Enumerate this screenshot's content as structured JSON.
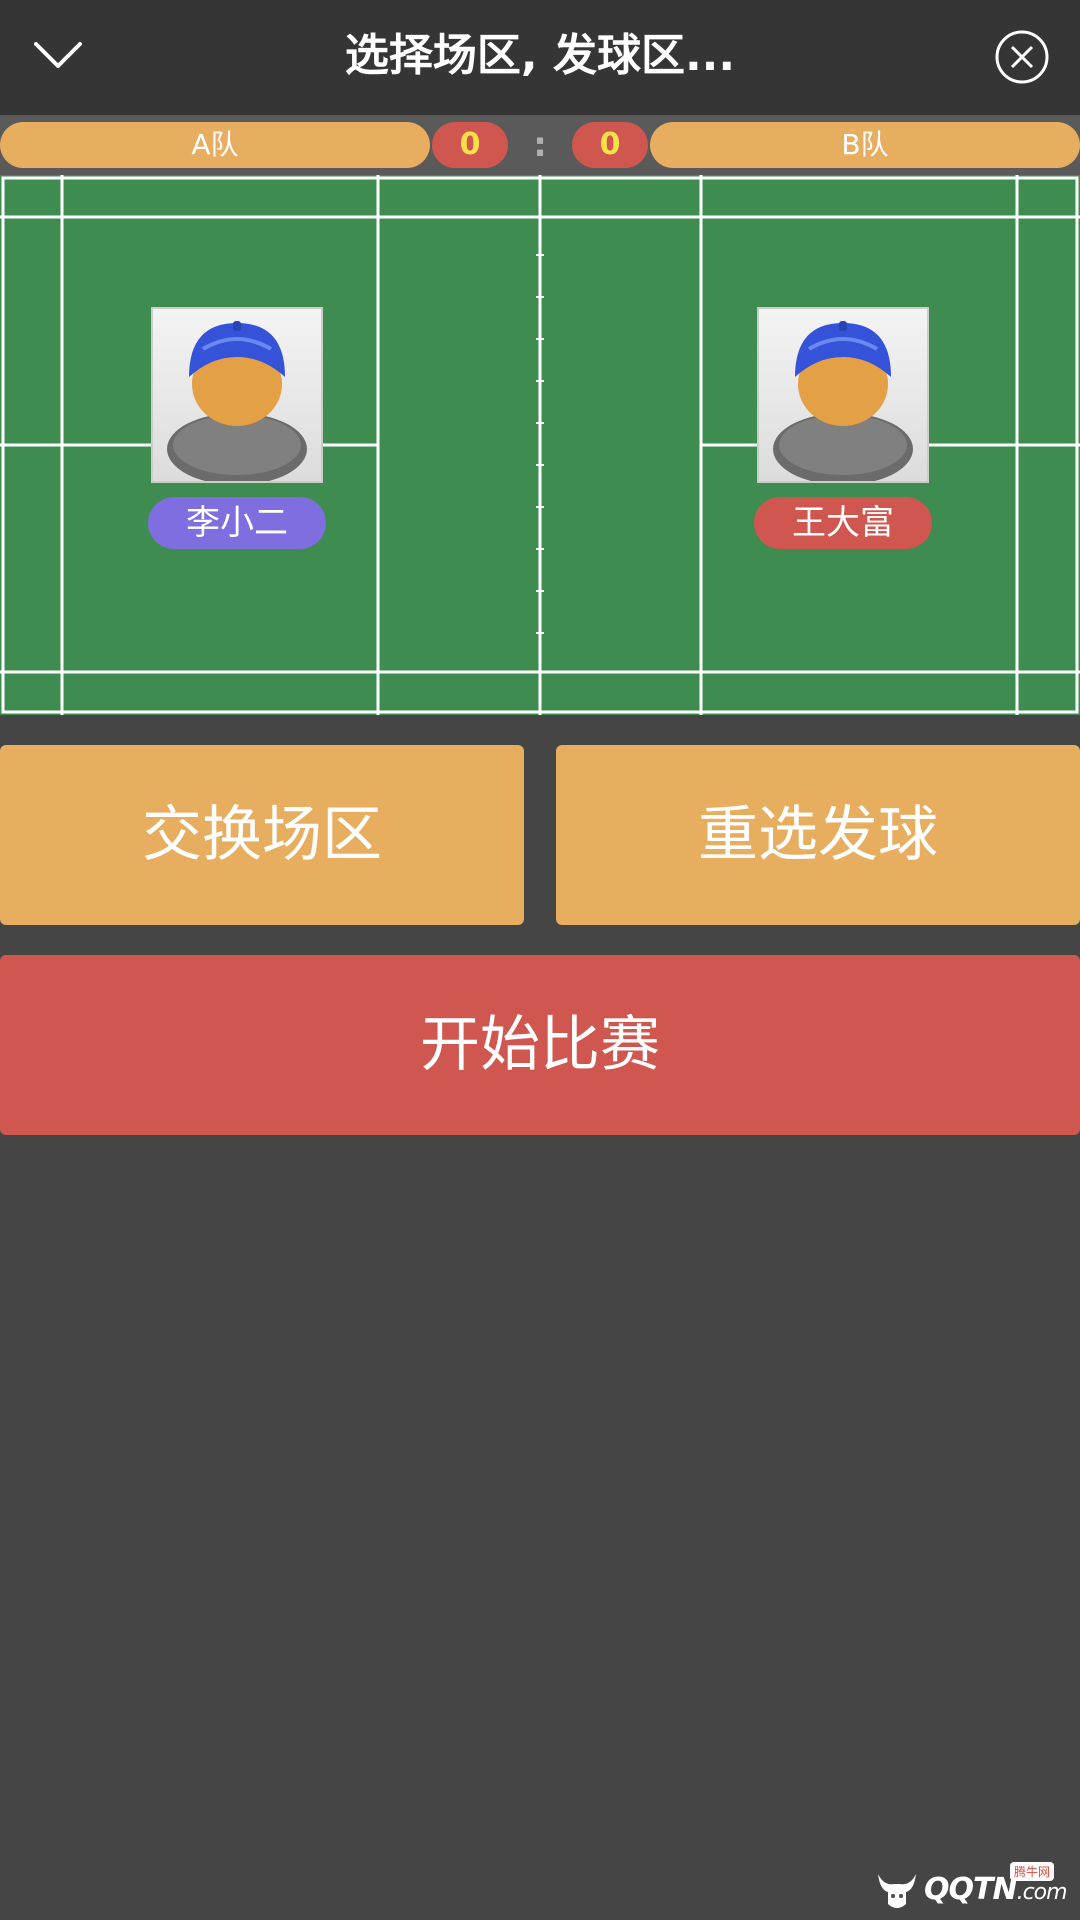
{
  "header": {
    "title": "选择场区, 发球区...",
    "back_icon": "chevron-down-icon",
    "close_icon": "close-circle-icon"
  },
  "scoreboard": {
    "team_a": "A队",
    "team_b": "B队",
    "score_a": "0",
    "score_b": "0",
    "separator": ":"
  },
  "court": {
    "player_left": {
      "name": "李小二",
      "badge_color": "#7e6ee0"
    },
    "player_right": {
      "name": "王大富",
      "badge_color": "#d0574f"
    },
    "court_color": "#3e8c50",
    "line_color": "#ffffff"
  },
  "actions": {
    "swap_label": "交换场区",
    "reselect_label": "重选发球",
    "start_label": "开始比赛"
  },
  "colors": {
    "accent_orange": "#e6ae5e",
    "accent_red": "#d0574f",
    "background": "#454545"
  },
  "watermark": {
    "text": "QQTN",
    "suffix": ".com",
    "badge": "腾牛网"
  }
}
